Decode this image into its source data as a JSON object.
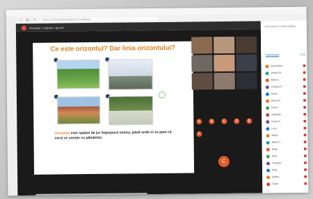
{
  "browser": {
    "url": "meet.jit.si/ZaciNajmanjiUrzaTricipKlasa"
  },
  "meeting": {
    "title": "meetings / Vzglasie / geonzi"
  },
  "slide": {
    "title": "Ce este orizontul? Dar linia orizontului?",
    "keyword": "Orizontul",
    "text": " este spațiul de jur împrejurul nostru, până unde ni se pare că cerul se unește cu pământul."
  },
  "sidebar": {
    "header": "Participanți și chatul întâlnirii",
    "tabs": [
      {
        "label": "Participanți"
      },
      {
        "label": "Chat"
      }
    ],
    "participants": [
      {
        "name": "Ana Maria",
        "color": "#e07b1f"
      },
      {
        "name": "Andrei M.",
        "color": "#2a9d8f"
      },
      {
        "name": "Bianca",
        "color": "#e05a2a"
      },
      {
        "name": "Cristina P.",
        "color": "#6d4c9f"
      },
      {
        "name": "Daria",
        "color": "#1976d2"
      },
      {
        "name": "Elena B.",
        "color": "#e07b1f"
      },
      {
        "name": "Florin",
        "color": "#43a047"
      },
      {
        "name": "Gabriela",
        "color": "#d23b3b"
      },
      {
        "name": "Ioana S.",
        "color": "#6d4c9f"
      },
      {
        "name": "Luca",
        "color": "#1976d2"
      },
      {
        "name": "Maria",
        "color": "#e07b1f"
      },
      {
        "name": "Mihai R.",
        "color": "#2a9d8f"
      },
      {
        "name": "Radu",
        "color": "#e05a2a"
      },
      {
        "name": "Sara",
        "color": "#43a047"
      },
      {
        "name": "Teodora",
        "color": "#6d4c9f"
      },
      {
        "name": "Vlad",
        "color": "#1976d2"
      },
      {
        "name": "Ștefan",
        "color": "#e07b1f"
      },
      {
        "name": "Tudor",
        "color": "#d23b3b"
      }
    ]
  },
  "videoTiles": [
    {
      "color": "#8a6b52"
    },
    {
      "color": "#b5977c"
    },
    {
      "color": "#4a3b33"
    },
    {
      "color": "#6f6860"
    },
    {
      "color": "#c79a7a"
    },
    {
      "color": "#3b3f4a"
    },
    {
      "color": "#5f4d44"
    },
    {
      "color": "#8c7a6d"
    },
    {
      "color": "#2d2d36"
    }
  ],
  "avatars": [
    {
      "initial": "A",
      "color": "#e05a2a"
    },
    {
      "initial": "B",
      "color": "#e05a2a"
    },
    {
      "initial": "C",
      "color": "#e05a2a"
    },
    {
      "initial": "D",
      "color": "#e05a2a"
    },
    {
      "initial": "E",
      "color": "#e05a2a"
    },
    {
      "initial": "F",
      "color": "#e05a2a"
    }
  ],
  "selfAvatar": {
    "initial": "C"
  }
}
